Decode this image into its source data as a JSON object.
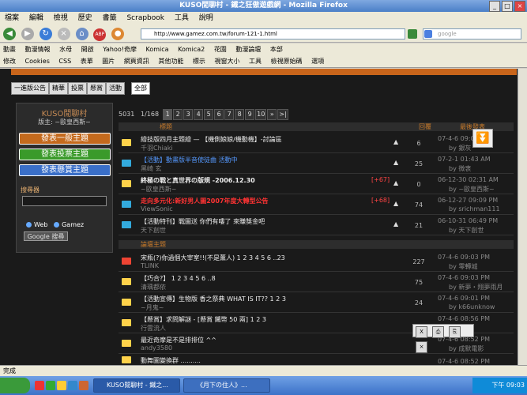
{
  "window": {
    "title": "KUSO閒聊村 - 鐵之狂傲遊戲網 - Mozilla Firefox"
  },
  "menu": [
    "檔案",
    "編輯",
    "檢視",
    "歷史",
    "書籤",
    "Scrapbook",
    "工具",
    "說明"
  ],
  "url": "http://www.gamez.com.tw/forum-121-1.html",
  "search_placeholder": "google",
  "bookmarks1": [
    "動畫",
    "動漫情報",
    "水母",
    "開啟",
    "Yahoo!奇摩",
    "Komica",
    "Komica2",
    "花園",
    "動漫論壇",
    "本部"
  ],
  "bookmarks2": [
    "修改",
    "Cookies",
    "CSS",
    "表單",
    "圖片",
    "網頁資訊",
    "其他功能",
    "標示",
    "視窗大小",
    "工具",
    "檢視原始碼",
    "選項"
  ],
  "tabs": [
    "一進版公告",
    "精華",
    "投票",
    "懸賞",
    "活動",
    "全部"
  ],
  "sidebar": {
    "title": "KUSO閒聊村",
    "mods": "版主: ~歐皇西斯~",
    "btn1": "發表一般主題",
    "btn2": "發表投票主題",
    "btn3": "發表懸賞主題",
    "search_label": "搜尋器",
    "radio_web": "Web",
    "radio_gamez": "Gamez",
    "google_btn": "Google 搜尋"
  },
  "pager": {
    "total": "5031",
    "pages": "1/168",
    "nums": [
      "1",
      "2",
      "3",
      "4",
      "5",
      "6",
      "7",
      "8",
      "9",
      "10"
    ],
    "next": "»",
    "last": ">|"
  },
  "thead": {
    "title": "標題",
    "replies": "回覆",
    "last": "最後發表"
  },
  "pinned": [
    {
      "title": "繪技版四月主題繪 — 【機側娘娘/機動機】-討論區",
      "author": "千羽Chiaki",
      "replies": "6",
      "date": "07-4-6 09:07 PM",
      "by": "by 銀灰",
      "color": "#ffd24a"
    },
    {
      "title": "【活動】動畫版半音使徒曲 活動中",
      "author": "黑崎 玄",
      "replies": "25",
      "date": "07-2-1 01:43 AM",
      "by": "by 微衷",
      "color": "#ffd24a"
    },
    {
      "title": "終極の戰と真世界の版規 -2006.12.30",
      "author": "~歐皇西斯~",
      "replies": "0",
      "date": "06-12-30 02:31 AM",
      "by": "by ~歐皇西斯~",
      "hot": "[+67]",
      "color": "#ffd24a"
    },
    {
      "title": "走向多元化:新好男人圖2007年度大轉型公告",
      "author": "ViewSonic",
      "replies": "74",
      "date": "06-12-27 09:09 PM",
      "by": "by srichman111",
      "hot": "[+68]",
      "color": "#3ad"
    },
    {
      "title": "【活動特刊】戰圖送 你們有嘍了 來賺獎金吧",
      "author": "天下創世",
      "replies": "21",
      "date": "06-10-31 06:49 PM",
      "by": "by 天下創世",
      "color": "#3ad"
    }
  ],
  "section2": "論壇主題",
  "threads": [
    {
      "title": "宋瓶(?)你過個大宰室!!(不是薰人) 1 2 3 4 5 6 ..23",
      "author": "TLINK",
      "replies": "227",
      "date": "07-4-6 09:03 PM",
      "by": "by 零轉城",
      "color": "#e43"
    },
    {
      "title": "【巧合?】 1 2 3 4 5 6 ..8",
      "author": "清瑀都依",
      "replies": "75",
      "date": "07-4-6 09:03 PM",
      "by": "by 新夢・翔夢雨月",
      "color": "#ffd24a"
    },
    {
      "title": "【活動宣傳】生物版 香之祭典 WHAT IS IT?? 1 2 3",
      "author": "~月鬼~",
      "replies": "24",
      "date": "07-4-6 09:01 PM",
      "by": "by k66unknow",
      "color": "#ffd24a"
    },
    {
      "title": "【懸賞】求問解謎 - [懸賞 鐵幣 50 兩] 1 2 3",
      "author": "行雲流人",
      "replies": "",
      "date": "07-4-6 08:56 PM",
      "by": "",
      "color": "#ffd24a"
    },
    {
      "title": "最近奇摩是不是排排位 ^^",
      "author": "andy3580",
      "replies": "6",
      "date": "07-4-6 08:52 PM",
      "by": "by 成默電影",
      "color": "#ffd24a"
    },
    {
      "title": "動舞圖變換群 ..........",
      "author": "",
      "replies": "",
      "date": "07-4-6 08:52 PM",
      "by": "",
      "color": "#ffd24a"
    }
  ],
  "status": "完成",
  "taskbar": {
    "btn1": "KUSO閒聊村 - 鐵之...",
    "btn2": "《月下の住人》...",
    "clock": "下午 09:03"
  }
}
